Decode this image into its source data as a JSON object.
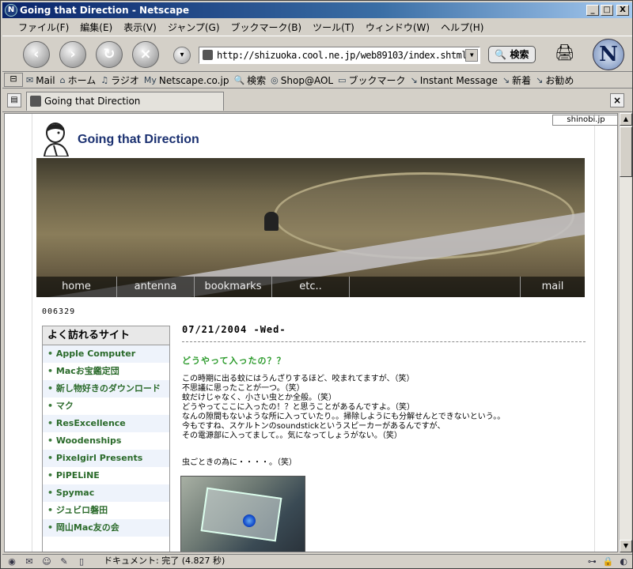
{
  "window": {
    "title": "Going that Direction - Netscape",
    "buttons": [
      "_",
      "□",
      "X"
    ]
  },
  "menubar": [
    "ファイル(F)",
    "編集(E)",
    "表示(V)",
    "ジャンプ(G)",
    "ブックマーク(B)",
    "ツール(T)",
    "ウィンドウ(W)",
    "ヘルプ(H)"
  ],
  "navbar": {
    "url": "http://shizuoka.cool.ne.jp/web89103/index.shtml",
    "search_label": "検索"
  },
  "personal_toolbar": [
    "Mail",
    "ホーム",
    "ラジオ",
    "Netscape.co.jp",
    "検索",
    "Shop@AOL",
    "ブックマーク",
    "Instant Message",
    "新着",
    "お勧め"
  ],
  "tab": {
    "label": "Going that Direction"
  },
  "page": {
    "shinobi": "shinobi.jp",
    "site_title": "Going that Direction",
    "nav": [
      "home",
      "antenna",
      "bookmarks",
      "etc..",
      "mail"
    ],
    "counter": "006329",
    "sidebar": {
      "heading": "よく訪れるサイト",
      "items": [
        "Apple Computer",
        "Macお宝鑑定団",
        "新し物好きのダウンロード",
        "マク",
        "ResExcellence",
        "Woodenships",
        "Pixelgirl Presents",
        "PiPELiNE",
        "Spymac",
        "ジュビロ磐田",
        "岡山Mac友の会"
      ]
    },
    "entry": {
      "date": "07/21/2004 -Wed-",
      "title": "どうやって入ったの？？",
      "lines": [
        "この時期に出る蚊にはうんざりするほど、咬まれてますが、（笑）",
        "不思議に思ったことが一つ。（笑）",
        "蚊だけじゃなく、小さい虫とか全般。（笑）",
        "どうやってここに入ったの！？と思うことがあるんですよ。（笑）",
        "なんの隙間もないような所に入っていたり。。掃除しようにも分解せんとできないという。。",
        "今もですね、スケルトンのsoundstickというスピーカーがあるんですが、",
        "その電源部に入ってまして。。気になってしょうがない。（笑）"
      ],
      "note": "虫ごときの為に・・・・。（笑）"
    }
  },
  "status": {
    "text": "ドキュメント: 完了 (4.827 秒)"
  }
}
